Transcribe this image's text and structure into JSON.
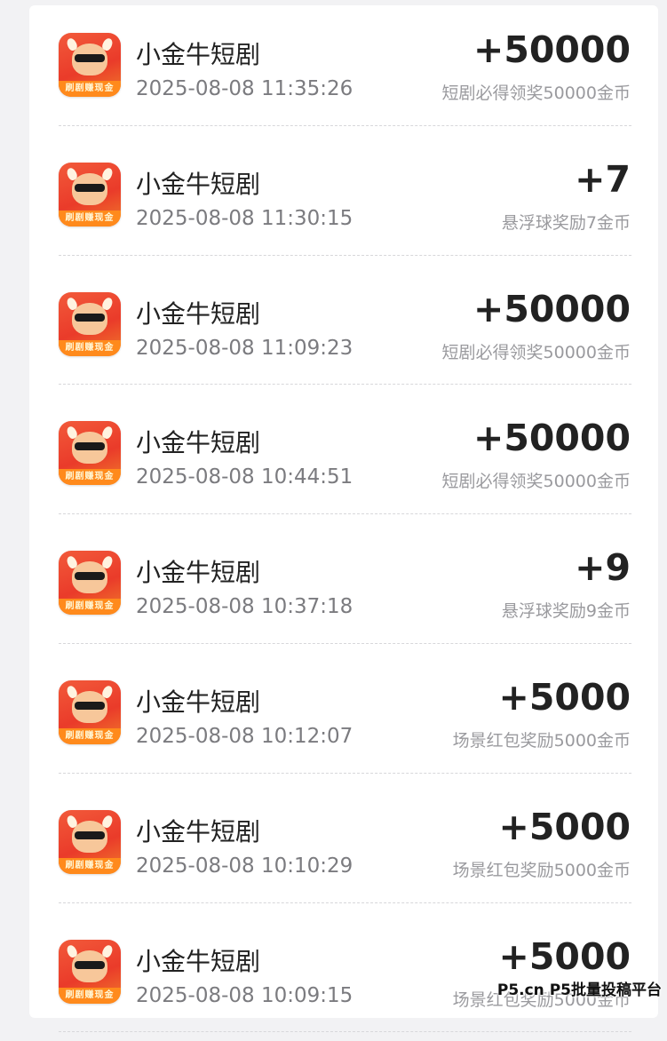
{
  "records": [
    {
      "app_name": "小金牛短剧",
      "icon_banner": "刷剧赚现金",
      "time": "2025-08-08 11:35:26",
      "amount": "+50000",
      "desc": "短剧必得领奖50000金币"
    },
    {
      "app_name": "小金牛短剧",
      "icon_banner": "刷剧赚现金",
      "time": "2025-08-08 11:30:15",
      "amount": "+7",
      "desc": "悬浮球奖励7金币"
    },
    {
      "app_name": "小金牛短剧",
      "icon_banner": "刷剧赚现金",
      "time": "2025-08-08 11:09:23",
      "amount": "+50000",
      "desc": "短剧必得领奖50000金币"
    },
    {
      "app_name": "小金牛短剧",
      "icon_banner": "刷剧赚现金",
      "time": "2025-08-08 10:44:51",
      "amount": "+50000",
      "desc": "短剧必得领奖50000金币"
    },
    {
      "app_name": "小金牛短剧",
      "icon_banner": "刷剧赚现金",
      "time": "2025-08-08 10:37:18",
      "amount": "+9",
      "desc": "悬浮球奖励9金币"
    },
    {
      "app_name": "小金牛短剧",
      "icon_banner": "刷剧赚现金",
      "time": "2025-08-08 10:12:07",
      "amount": "+5000",
      "desc": "场景红包奖励5000金币"
    },
    {
      "app_name": "小金牛短剧",
      "icon_banner": "刷剧赚现金",
      "time": "2025-08-08 10:10:29",
      "amount": "+5000",
      "desc": "场景红包奖励5000金币"
    },
    {
      "app_name": "小金牛短剧",
      "icon_banner": "刷剧赚现金",
      "time": "2025-08-08 10:09:15",
      "amount": "+5000",
      "desc": "场景红包奖励5000金币"
    }
  ],
  "watermark": "P5.cn P5批量投稿平台",
  "colors": {
    "icon_red": "#ea3b2a",
    "icon_orange": "#ff8a1c",
    "amount_text": "#222222",
    "secondary_text": "#9a9a9e"
  }
}
